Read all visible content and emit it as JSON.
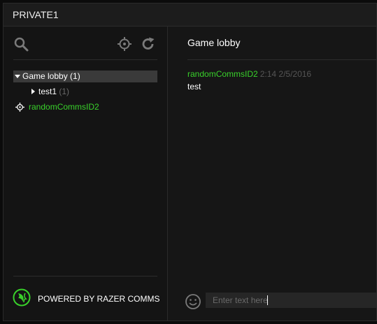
{
  "window": {
    "title": "PRIVATE1"
  },
  "toolbar": {
    "icons": [
      "search-icon",
      "locate-icon",
      "refresh-icon"
    ]
  },
  "tree": {
    "lobby_label": "Game lobby",
    "lobby_count": "(1)",
    "channel_label": "test1",
    "channel_count": "(1)",
    "user_label": "randomCommsID2"
  },
  "footer": {
    "label": "POWERED BY RAZER COMMS"
  },
  "chat": {
    "title": "Game lobby",
    "message": {
      "author": "randomCommsID2",
      "timestamp": "2:14 2/5/2016",
      "text": "test"
    },
    "input_placeholder": "Enter text here"
  },
  "colors": {
    "accent_green": "#39d12b",
    "background": "#141414",
    "selection": "#3a3a3a",
    "muted_text": "#6a6a6a"
  }
}
